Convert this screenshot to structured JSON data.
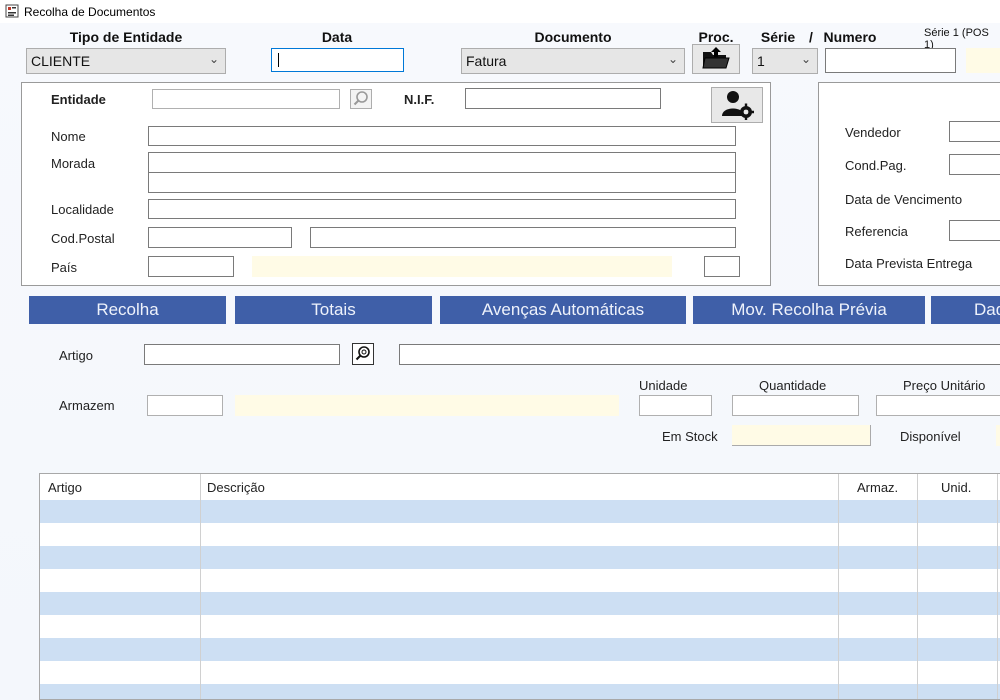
{
  "window": {
    "title": "Recolha de Documentos"
  },
  "header": {
    "tipo_label": "Tipo de Entidade",
    "tipo_value": "CLIENTE",
    "data_label": "Data",
    "data_value": "",
    "documento_label": "Documento",
    "documento_value": "Fatura",
    "proc_label": "Proc.",
    "serie_label": "Série",
    "slash": "/",
    "numero_label": "Numero",
    "serie_value": "1",
    "numero_value": "",
    "serie_note": "Série 1 (POS 1)"
  },
  "entity": {
    "entidade_label": "Entidade",
    "nif_label": "N.I.F.",
    "nome_label": "Nome",
    "morada_label": "Morada",
    "localidade_label": "Localidade",
    "codpostal_label": "Cod.Postal",
    "pais_label": "País"
  },
  "right_panel": {
    "vendedor_label": "Vendedor",
    "condpag_label": "Cond.Pag.",
    "vencimento_label": "Data de Vencimento",
    "referencia_label": "Referencia",
    "entrega_label": "Data Prevista Entrega"
  },
  "tabs": [
    "Recolha",
    "Totais",
    "Avenças Automáticas",
    "Mov. Recolha Prévia",
    "Dad"
  ],
  "item": {
    "artigo_label": "Artigo",
    "armazem_label": "Armazem",
    "unidade_label": "Unidade",
    "quantidade_label": "Quantidade",
    "preco_label": "Preço Unitário",
    "stock_label": "Em Stock",
    "disponivel_label": "Disponível"
  },
  "grid": {
    "columns": [
      "Artigo",
      "Descrição",
      "Armaz.",
      "Unid."
    ]
  },
  "colors": {
    "tab_bg": "#3f5fa8",
    "row_alt": "#cddff3",
    "readonly_field": "#fffbe6",
    "focus_border": "#0078d7"
  },
  "icons": [
    "app-icon",
    "folder-open-icon",
    "user-gear-icon",
    "magnifier-icon",
    "chevron-down-icon"
  ]
}
